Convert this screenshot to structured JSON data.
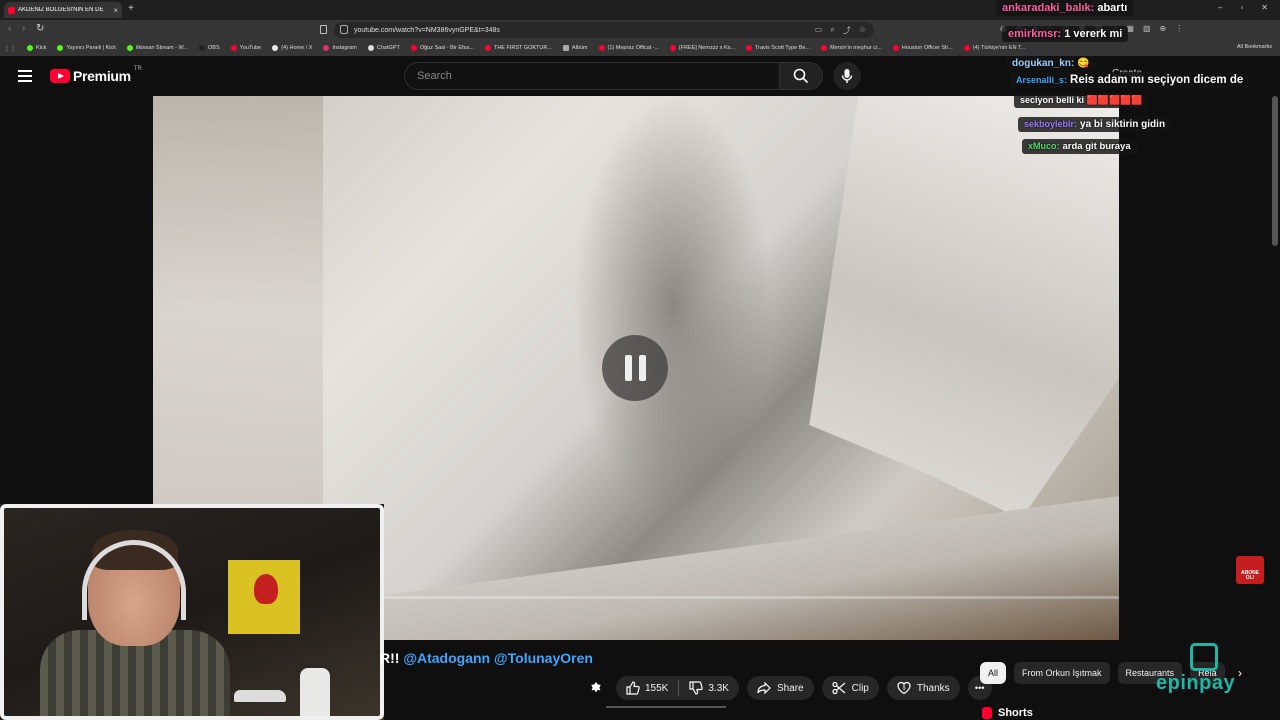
{
  "browser": {
    "tab_title": "AKDENİZ BÖLGESİ'NİN EN DE",
    "tab_close": "×",
    "new_tab": "+",
    "url": "youtube.com/watch?v=NM386vynGPE&t=348s",
    "win_min": "–",
    "win_max": "▫",
    "win_close": "✕",
    "back": "‹",
    "forward": "›",
    "reload": "↻",
    "apps": "⋮⋮",
    "omni_icons": [
      "▭",
      "⌕",
      "⤴",
      "☆"
    ],
    "all_bookmarks": "All Bookmarks",
    "bookmarks": [
      {
        "label": "Kick",
        "color": "#53fc18"
      },
      {
        "label": "Yayıncı Paneli | Kick",
        "color": "#53fc18"
      },
      {
        "label": "ilkinsan Stream - W...",
        "color": "#53fc18"
      },
      {
        "label": "OBS",
        "color": "#222222"
      },
      {
        "label": "YouTube",
        "color": "#ff0033"
      },
      {
        "label": "(4) Home / X",
        "color": "#eeeeee"
      },
      {
        "label": "Instagram",
        "color": "#e1306c"
      },
      {
        "label": "ChatGPT",
        "color": "#dddddd"
      },
      {
        "label": "Oğuz Sasi - Bir Efsa...",
        "color": "#ff0033"
      },
      {
        "label": "THE FIRST GOKTUR...",
        "color": "#ff0033"
      },
      {
        "label": "Albüm",
        "color": "#aaaaaa"
      },
      {
        "label": "(1) Mepraz Offical -...",
        "color": "#ff0033"
      },
      {
        "label": "[FREE] Nemzzz x Ks...",
        "color": "#ff0033"
      },
      {
        "label": "Travis Scott Type Be...",
        "color": "#ff0033"
      },
      {
        "label": "Mersin'in meşhur ci...",
        "color": "#ff0033"
      },
      {
        "label": "Houston Officer Sh...",
        "color": "#ff0033"
      },
      {
        "label": "(4) Türkiye'nin EN T...",
        "color": "#ff0033"
      }
    ]
  },
  "youtube": {
    "brand": "Premium",
    "country": "TR",
    "search_placeholder": "Search",
    "create_label": "Create",
    "video_title_prefix": "R!! ",
    "mentions": "@Atadogann @TolunayOren",
    "progress_fraction": 0.0,
    "actions": {
      "likes": "155K",
      "dislikes": "3.3K",
      "share": "Share",
      "clip": "Clip",
      "thanks": "Thanks",
      "more": "•••"
    },
    "chips": [
      "All",
      "From Orkun Işıtmak",
      "Restaurants",
      "Rela"
    ],
    "shorts_label": "Shorts"
  },
  "overlays": {
    "subscribe_sticker": "ABONE OL!",
    "epinpay": "epinpay",
    "chat": [
      {
        "user": "ankaradaki_balık:",
        "msg": "abartı",
        "ucolor": "#ff5fa2"
      },
      {
        "user": "emirkmsr:",
        "msg": "1 vererk mi",
        "ucolor": "#ff5fa2"
      },
      {
        "user": "dogukan_kn:",
        "msg": "😋",
        "ucolor": "#9bd0ff"
      },
      {
        "user": "Arsenalli_s:",
        "msg": "Reis adam mı seçiyon dicem de",
        "ucolor": "#3ea6ff"
      },
      {
        "user": "",
        "msg": "seciyon belli ki 🟥🟥🟥🟥🟥",
        "ucolor": "#ffffff"
      },
      {
        "user": "sekboyleblr:",
        "msg": "ya bi siktirin gidin",
        "ucolor": "#9b7bff"
      },
      {
        "user": "xMuco:",
        "msg": "arda git buraya",
        "ucolor": "#53d769"
      }
    ]
  }
}
